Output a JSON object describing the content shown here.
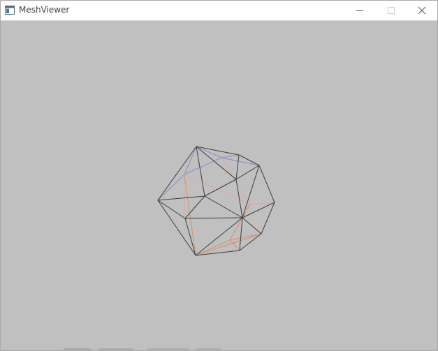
{
  "window": {
    "title": "MeshViewer",
    "icons": {
      "app": "app-window-icon",
      "minimize": "minimize-icon",
      "maximize": "maximize-icon",
      "close": "close-icon"
    },
    "colors": {
      "background": "#c0c0c0",
      "titlebar": "#ffffff",
      "title_text": "#444444"
    }
  },
  "viewport": {
    "content": "wireframe-icosahedron",
    "colors": {
      "edge_front": "#3c3c3c",
      "edge_back_top": "#8c8cc8",
      "edge_back_bottom": "#d8906c",
      "edge_back_mid": "#e0a8a8"
    }
  }
}
